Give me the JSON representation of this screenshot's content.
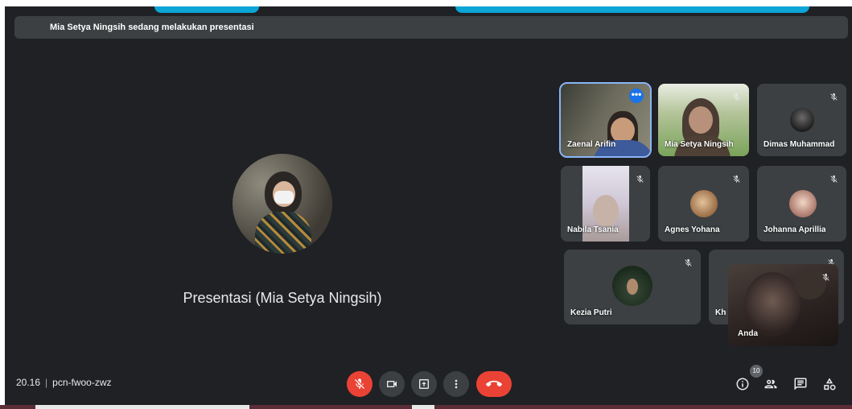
{
  "banner": {
    "text": "Mia Setya Ningsih sedang melakukan presentasi"
  },
  "presenter": {
    "label": "Presentasi (Mia Setya Ningsih)"
  },
  "participants": [
    {
      "name": "Zaenal Arifin"
    },
    {
      "name": "Mia Setya Ningsih"
    },
    {
      "name": "Dimas Muhammad"
    },
    {
      "name": "Nabila Tsania"
    },
    {
      "name": "Agnes Yohana"
    },
    {
      "name": "Johanna Aprillia"
    },
    {
      "name": "Kezia Putri"
    },
    {
      "name": "Kh"
    },
    {
      "name": "Anda"
    }
  ],
  "meeting": {
    "time": "20.16",
    "separator": "|",
    "code": "pcn-fwoo-zwz"
  },
  "participant_count": "10",
  "colors": {
    "background": "#202124",
    "tile": "#3c4043",
    "accent": "#8ab4f8",
    "danger": "#ea4335",
    "brand_blue": "#1a73e8"
  },
  "icons": {
    "controls": [
      "mic-off-icon",
      "camera-icon",
      "present-screen-icon",
      "more-options-icon",
      "end-call-icon"
    ],
    "right": [
      "info-icon",
      "people-icon",
      "chat-icon",
      "activities-icon"
    ]
  }
}
